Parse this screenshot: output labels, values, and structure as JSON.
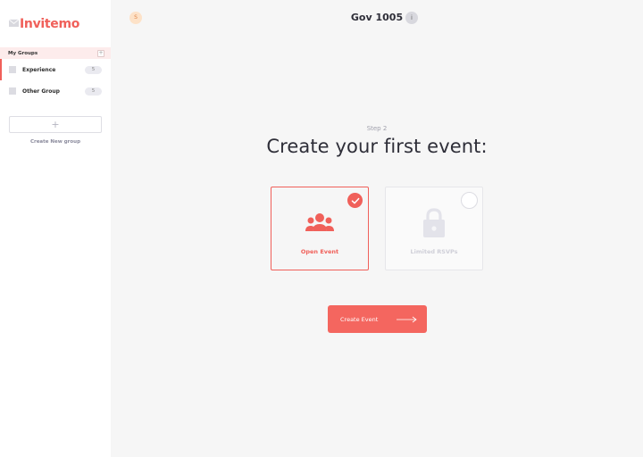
{
  "app": {
    "logo_text": "Invitemo",
    "brand_color": "#f0605a"
  },
  "sidebar": {
    "groups_title": "My Groups",
    "groups_add_label": "+",
    "items": [
      {
        "label": "Experience",
        "count": "5",
        "active": true
      },
      {
        "label": "Other Group",
        "count": "5",
        "active": false
      }
    ],
    "create_button_label": "+",
    "create_group_label": "Create New group"
  },
  "header": {
    "user_badge": "S",
    "title": "Gov 1005",
    "info_label": "i"
  },
  "main": {
    "step_label": "Step 2",
    "heading": "Create your first event:",
    "options": [
      {
        "label": "Open Event",
        "icon": "group-icon",
        "selected": true
      },
      {
        "label": "Limited RSVPs",
        "icon": "lock-icon",
        "selected": false
      }
    ],
    "cta_label": "Create Event"
  }
}
